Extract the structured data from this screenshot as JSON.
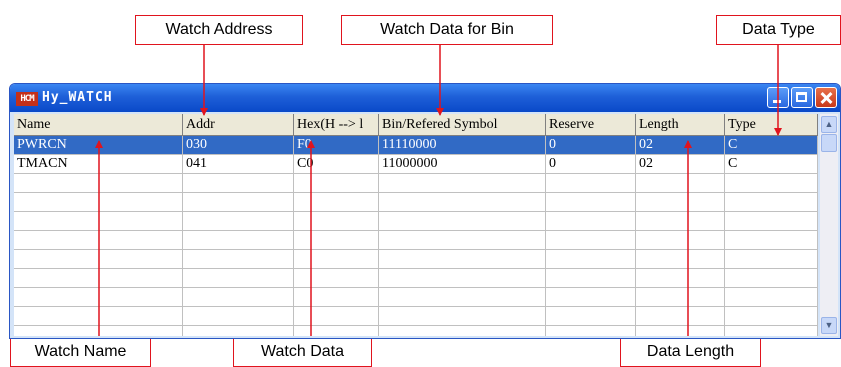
{
  "callouts": {
    "watch_address": "Watch Address",
    "watch_data_for_bin": "Watch Data for Bin",
    "data_type": "Data Type",
    "watch_name": "Watch Name",
    "watch_data": "Watch Data",
    "data_length": "Data Length"
  },
  "window": {
    "icon_text": "HCM",
    "title": "Hy_WATCH"
  },
  "table": {
    "columns": [
      "Name",
      "Addr",
      "Hex(H --> l",
      "Bin/Refered Symbol",
      "Reserve",
      "Length",
      "Type"
    ],
    "rows": [
      {
        "name": "PWRCN",
        "addr": "030",
        "hex": "F0",
        "bin": "11110000",
        "reserve": "0",
        "length": "02",
        "type": "C"
      },
      {
        "name": "TMACN",
        "addr": "041",
        "hex": "C0",
        "bin": "11000000",
        "reserve": "0",
        "length": "02",
        "type": "C"
      }
    ]
  },
  "colors": {
    "callout_border": "#e0141e",
    "arrow": "#e0141e",
    "selection": "#316ac5",
    "titlebar": "#0a49c8"
  }
}
